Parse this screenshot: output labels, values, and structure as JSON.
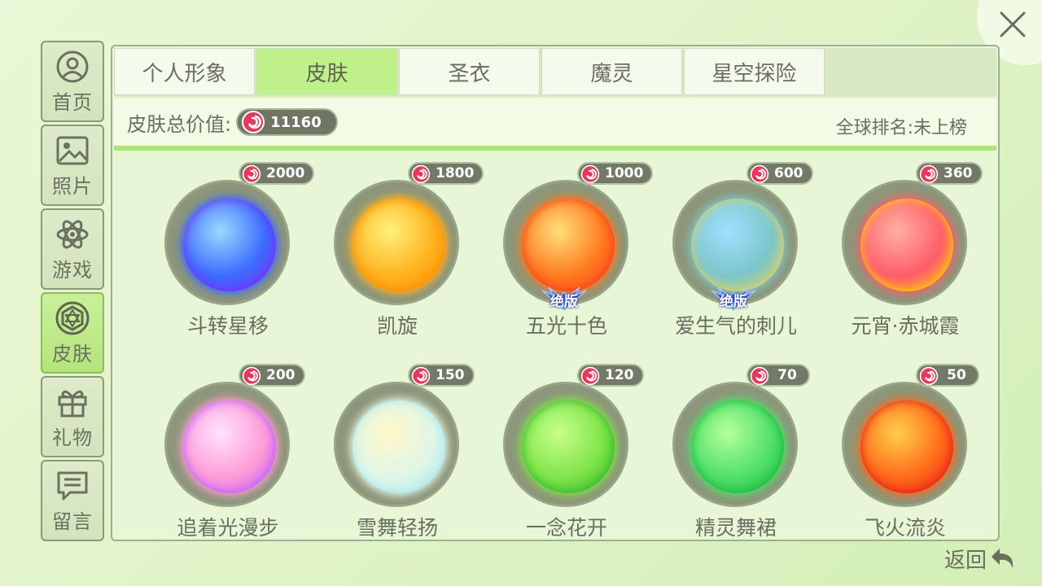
{
  "sidebar": {
    "items": [
      {
        "label": "首页",
        "icon": "user-circle-icon",
        "active": false
      },
      {
        "label": "照片",
        "icon": "photo-icon",
        "active": false
      },
      {
        "label": "游戏",
        "icon": "atom-icon",
        "active": false
      },
      {
        "label": "皮肤",
        "icon": "skin-ring-icon",
        "active": true
      },
      {
        "label": "礼物",
        "icon": "gift-icon",
        "active": false
      },
      {
        "label": "留言",
        "icon": "message-icon",
        "active": false
      }
    ]
  },
  "tabs": [
    {
      "label": "个人形象",
      "active": false
    },
    {
      "label": "皮肤",
      "active": true
    },
    {
      "label": "圣衣",
      "active": false
    },
    {
      "label": "魔灵",
      "active": false
    },
    {
      "label": "星空探险",
      "active": false
    }
  ],
  "summary": {
    "total_label": "皮肤总价值:",
    "total_value": "11160",
    "rank_text": "全球排名:未上榜"
  },
  "skins": [
    {
      "name": "斗转星移",
      "price": "2000",
      "badge": "",
      "colors": [
        "#9ad9ff",
        "#3d6bff",
        "#7b2cff"
      ]
    },
    {
      "name": "凯旋",
      "price": "1800",
      "badge": "",
      "colors": [
        "#fff27a",
        "#ffb21f",
        "#ff8a00"
      ]
    },
    {
      "name": "五光十色",
      "price": "1000",
      "badge": "绝版",
      "colors": [
        "#ffe07a",
        "#ff7a1f",
        "#ff3b1a"
      ]
    },
    {
      "name": "爱生气的刺儿",
      "price": "600",
      "badge": "绝版",
      "colors": [
        "#9fe0ff",
        "#7cc6c9",
        "#e7d35b"
      ]
    },
    {
      "name": "元宵·赤城霞",
      "price": "360",
      "badge": "",
      "colors": [
        "#ffb0a0",
        "#ff5d6a",
        "#ffd400"
      ]
    },
    {
      "name": "追着光漫步",
      "price": "200",
      "badge": "",
      "colors": [
        "#ffe3ff",
        "#ff9bd7",
        "#b95cff"
      ]
    },
    {
      "name": "雪舞轻扬",
      "price": "150",
      "badge": "",
      "colors": [
        "#fff8c9",
        "#dff6e8",
        "#a7e8f0"
      ]
    },
    {
      "name": "一念花开",
      "price": "120",
      "badge": "",
      "colors": [
        "#c8ff8a",
        "#7fe44a",
        "#2fb52a"
      ]
    },
    {
      "name": "精灵舞裙",
      "price": "70",
      "badge": "",
      "colors": [
        "#b5ff9a",
        "#4fe06a",
        "#17b83a"
      ]
    },
    {
      "name": "飞火流炎",
      "price": "50",
      "badge": "",
      "colors": [
        "#ffcf4a",
        "#ff6a1a",
        "#e81a1a"
      ]
    }
  ],
  "footer": {
    "back_label": "返回"
  },
  "colors": {
    "active_green": "#bff08a",
    "panel_bg": "#e7f6d4",
    "coin_pink": "#e8375c"
  }
}
